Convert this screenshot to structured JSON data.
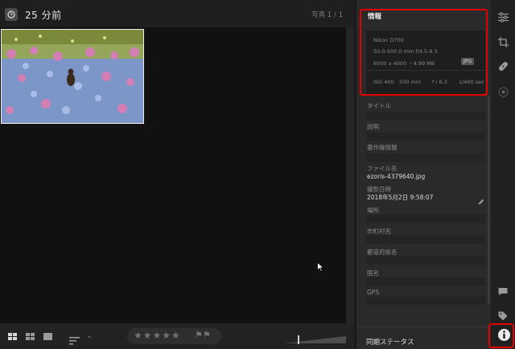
{
  "header": {
    "title": "25 分前",
    "page_count": "写真 1 / 1"
  },
  "toolbar": {
    "stars": "★★★★★",
    "flags": "⚑⚑"
  },
  "info": {
    "heading": "情報",
    "camera": "Nikon D700",
    "lens": "50.0-500.0 mm f/4.5-6.3",
    "size": "6000 x 4000 ・4.99 MB",
    "format": "JPG",
    "iso": "ISO 400",
    "focal": "500 mm",
    "aperture": "f / 6.3",
    "shutter": "1/400 sec"
  },
  "fields": {
    "title_label": "タイトル",
    "desc_label": "説明",
    "copyright_label": "著作権情報",
    "filename_label": "ファイル名",
    "filename_value": "ezoris-4379640.jpg",
    "date_label": "撮影日時",
    "date_value": "2018年5月2日 9:58:07",
    "location_label": "場所",
    "city_label": "市町村名",
    "state_label": "都道府県名",
    "country_label": "国名",
    "gps_label": "GPS"
  },
  "sync": {
    "label": "同期ステータス"
  },
  "icons": [
    "clock-icon",
    "sliders-icon",
    "crop-icon",
    "bandage-icon",
    "lens-icon",
    "comment-icon",
    "tag-icon",
    "info-icon"
  ],
  "colors": {
    "highlight": "#e40000",
    "background": "#161616",
    "panel": "#2a2a2a"
  }
}
